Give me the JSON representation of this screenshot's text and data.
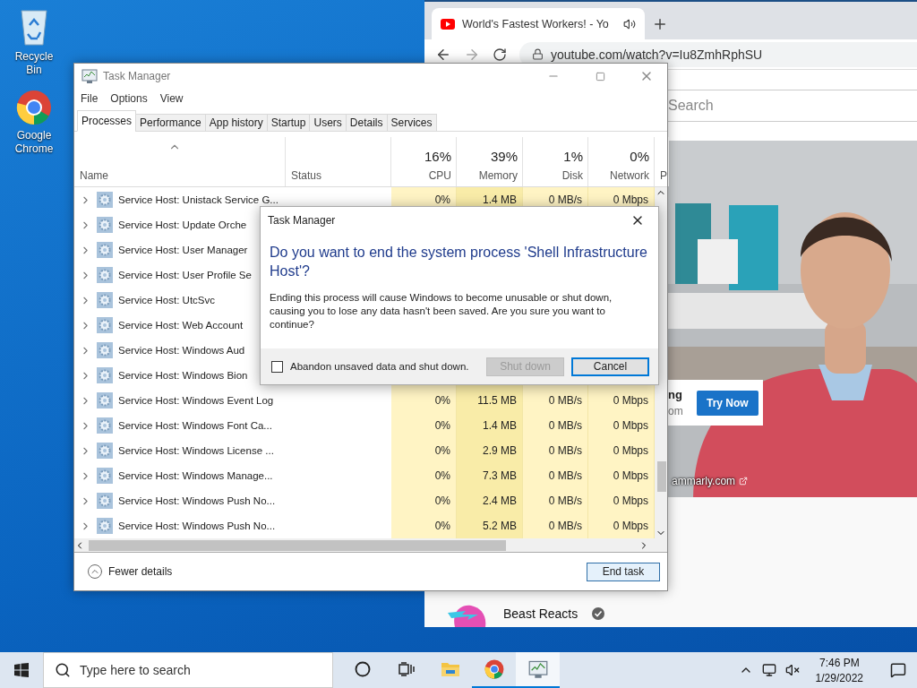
{
  "desktop_icons": [
    {
      "kind": "recycle",
      "label": "Recycle Bin"
    },
    {
      "kind": "chrome",
      "label": "Google Chrome"
    }
  ],
  "browser": {
    "tab_title": "World's Fastest Workers! - Yo",
    "url": "youtube.com/watch?v=Iu8ZmhRphSU",
    "search": {
      "placeholder": "Search"
    },
    "video": {
      "kind": "picture",
      "ad": {
        "title": "ng",
        "subtitle": "om",
        "button": "Try Now",
        "link": "ammarly.com"
      }
    },
    "channel": {
      "name": "Beast Reacts",
      "verified": true
    }
  },
  "task_manager": {
    "title": "Task Manager",
    "menu": [
      "File",
      "Options",
      "View"
    ],
    "tabs": [
      {
        "label": "Processes",
        "selected": true
      },
      {
        "label": "Performance",
        "selected": false
      },
      {
        "label": "App history",
        "selected": false
      },
      {
        "label": "Startup",
        "selected": false
      },
      {
        "label": "Users",
        "selected": false
      },
      {
        "label": "Details",
        "selected": false
      },
      {
        "label": "Services",
        "selected": false
      }
    ],
    "columns": [
      {
        "label": "Name",
        "sorted": true
      },
      {
        "label": "Status",
        "sorted": false
      },
      {
        "percent": "16%",
        "label": "CPU",
        "sorted": false
      },
      {
        "percent": "39%",
        "label": "Memory",
        "sorted": false
      },
      {
        "percent": "1%",
        "label": "Disk",
        "sorted": false
      },
      {
        "percent": "0%",
        "label": "Network",
        "sorted": false
      },
      {
        "label": "P",
        "sorted": false
      }
    ],
    "rows": [
      {
        "name": "Service Host: Unistack Service G...",
        "expanded": false,
        "cpu": "0%",
        "memory": "1.4 MB",
        "disk": "0 MB/s",
        "network": "0 Mbps"
      },
      {
        "name": "Service Host: Update Orche",
        "expanded": false
      },
      {
        "name": "Service Host: User Manager",
        "expanded": false
      },
      {
        "name": "Service Host: User Profile Se",
        "expanded": false
      },
      {
        "name": "Service Host: UtcSvc",
        "expanded": false
      },
      {
        "name": "Service Host: Web Account",
        "expanded": false
      },
      {
        "name": "Service Host: Windows Aud",
        "expanded": false
      },
      {
        "name": "Service Host: Windows Bion",
        "expanded": false
      },
      {
        "name": "Service Host: Windows Event Log",
        "expanded": false,
        "cpu": "0%",
        "memory": "11.5 MB",
        "disk": "0 MB/s",
        "network": "0 Mbps"
      },
      {
        "name": "Service Host: Windows Font Ca...",
        "expanded": false,
        "cpu": "0%",
        "memory": "1.4 MB",
        "disk": "0 MB/s",
        "network": "0 Mbps"
      },
      {
        "name": "Service Host: Windows License ...",
        "expanded": false,
        "cpu": "0%",
        "memory": "2.9 MB",
        "disk": "0 MB/s",
        "network": "0 Mbps"
      },
      {
        "name": "Service Host: Windows Manage...",
        "expanded": false,
        "cpu": "0%",
        "memory": "7.3 MB",
        "disk": "0 MB/s",
        "network": "0 Mbps"
      },
      {
        "name": "Service Host: Windows Push No...",
        "expanded": false,
        "cpu": "0%",
        "memory": "2.4 MB",
        "disk": "0 MB/s",
        "network": "0 Mbps"
      },
      {
        "name": "Service Host: Windows Push No...",
        "expanded": false,
        "cpu": "0%",
        "memory": "5.2 MB",
        "disk": "0 MB/s",
        "network": "0 Mbps"
      }
    ],
    "footer": {
      "toggle": "Fewer details",
      "button": "End task"
    }
  },
  "dialog": {
    "title": "Task Manager",
    "heading": "Do you want to end the system process 'Shell Infrastructure Host'?",
    "message": "Ending this process will cause Windows to become unusable or shut down, causing you to lose any data hasn't been saved. Are you sure you want to continue?",
    "checkbox": {
      "label": "Abandon unsaved data and shut down.",
      "checked": false
    },
    "buttons": [
      {
        "label": "Shut down",
        "disabled": true,
        "default": false
      },
      {
        "label": "Cancel",
        "disabled": false,
        "default": true
      }
    ]
  },
  "taskbar": {
    "search_placeholder": "Type here to search",
    "apps": [
      {
        "kind": "cortana",
        "running": false,
        "active": false
      },
      {
        "kind": "task-view",
        "running": false,
        "active": false
      },
      {
        "kind": "explorer",
        "running": false,
        "active": false
      },
      {
        "kind": "chrome",
        "running": true,
        "active": false
      },
      {
        "kind": "task-manager",
        "running": true,
        "active": true
      }
    ],
    "time": "7:46 PM",
    "date": "1/29/2022"
  }
}
